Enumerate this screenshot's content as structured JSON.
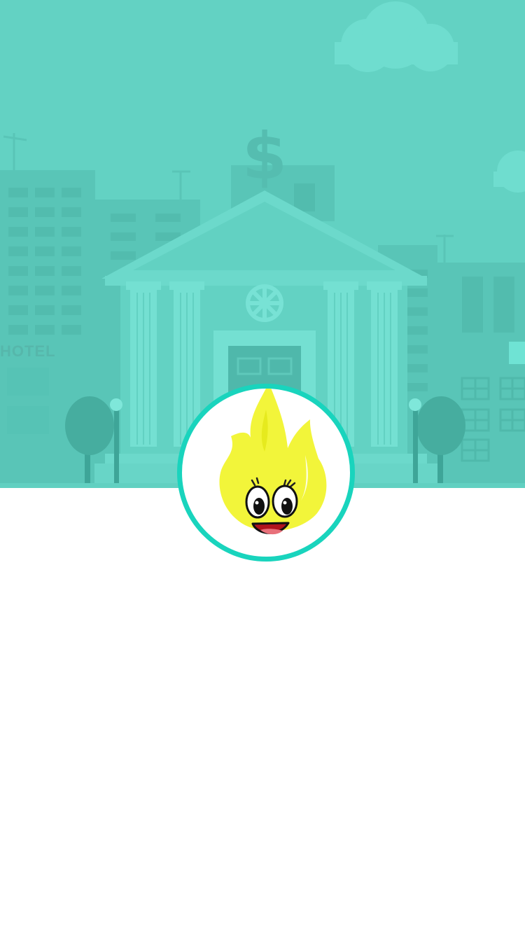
{
  "hero": {
    "background_color": "#62d1c2",
    "scene_icons": [
      "bank-icon",
      "dollar-sign-icon",
      "cloud-icon",
      "tree-icon",
      "street-lamp-icon"
    ],
    "sign_text": "HOTEL"
  },
  "avatar": {
    "icon": "flame-mascot-icon",
    "ring_color": "#19d4bd",
    "flame_color": "#f2f53a",
    "mouth_color": "#b0131c"
  }
}
